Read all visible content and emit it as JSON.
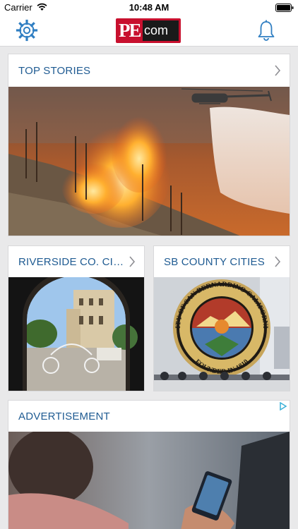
{
  "status_bar": {
    "carrier": "Carrier",
    "time": "10:48 AM",
    "icons": [
      "wifi-icon",
      "battery-icon"
    ]
  },
  "nav_bar": {
    "left_icon": "gear-icon",
    "right_icon": "bell-icon",
    "logo": {
      "pe": "PE",
      "com": "com",
      "brand_color": "#c8102e",
      "box_color": "#1a1a1a"
    }
  },
  "sections": {
    "top_stories": {
      "title": "TOP STORIES",
      "icon": "chevron-right-icon"
    },
    "riverside": {
      "title": "RIVERSIDE CO. CITIES",
      "icon": "chevron-right-icon"
    },
    "sb_county": {
      "title": "SB COUNTY CITIES",
      "icon": "chevron-right-icon"
    },
    "advertisement": {
      "title": "ADVERTISEMENT",
      "icon": "adchoices-icon"
    }
  },
  "seal": {
    "ring_text": "CITY OF SAN BERNARDINO CALIFORNIA",
    "bottom_text": "FOUNDED IN 1810"
  },
  "colors": {
    "section_title": "#1f5b92",
    "background": "#e9e9ea",
    "accent_blue": "#2f7ec2"
  }
}
